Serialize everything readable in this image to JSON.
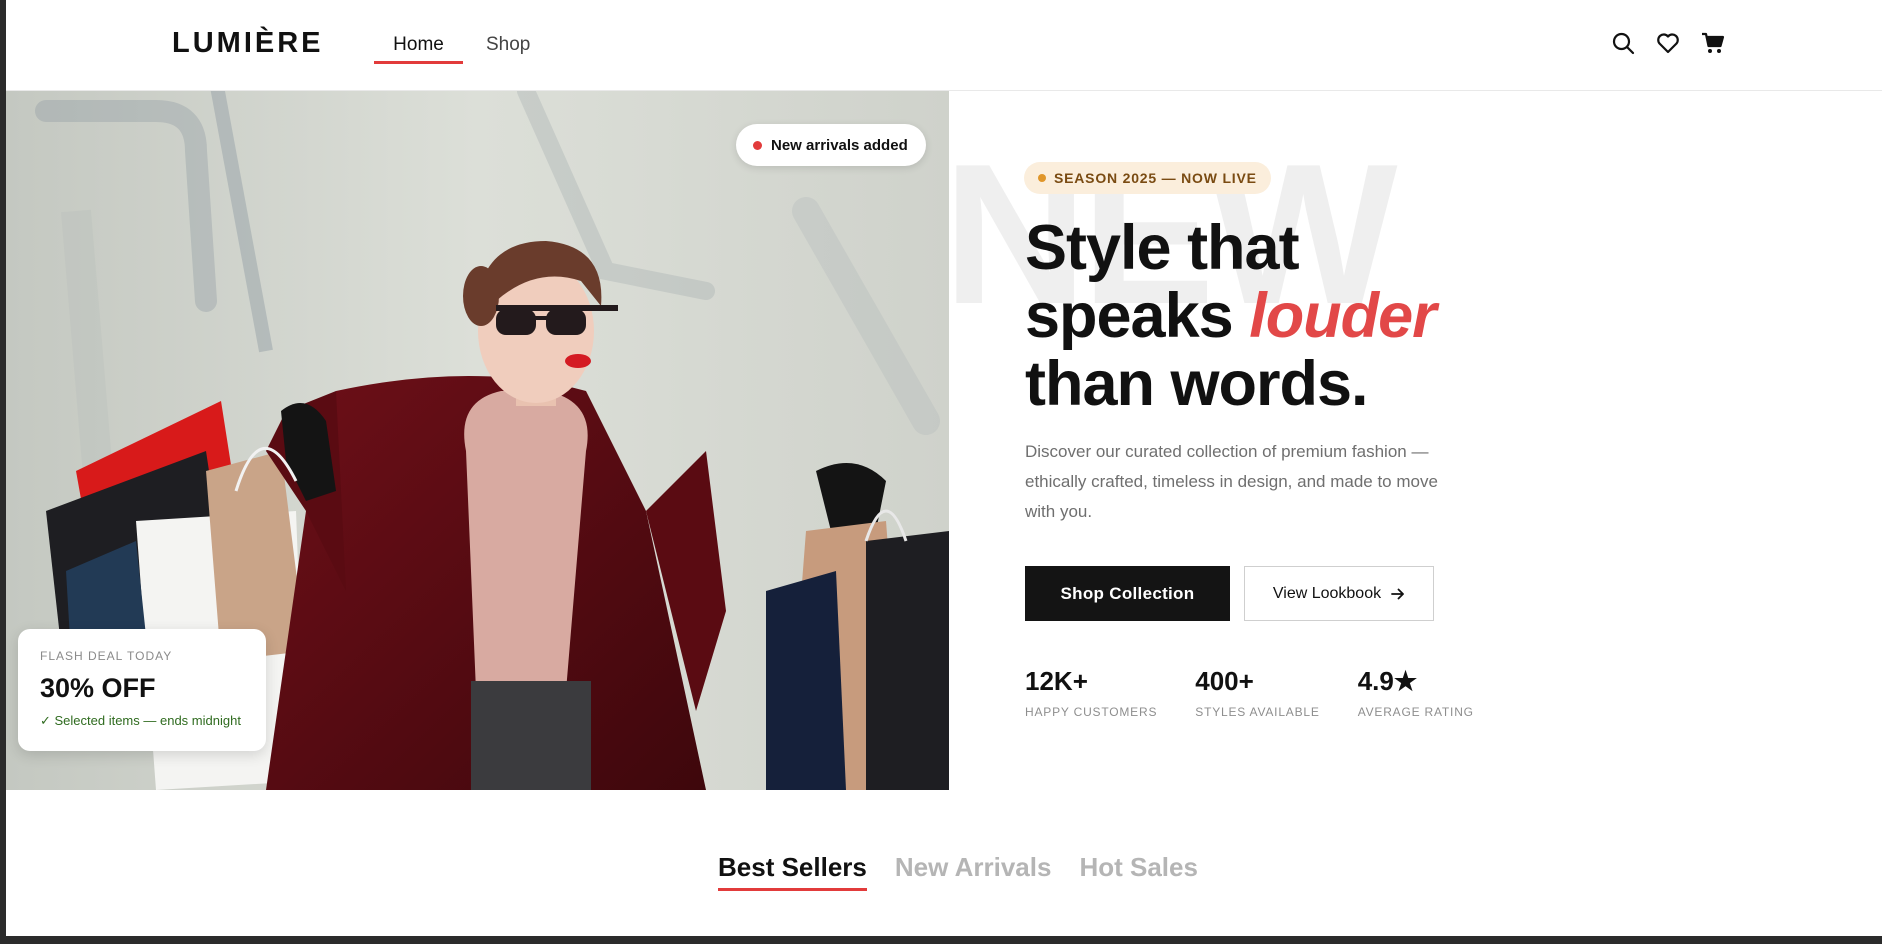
{
  "header": {
    "logo": "LUMIÈRE",
    "nav": [
      {
        "label": "Home",
        "active": true
      },
      {
        "label": "Shop",
        "active": false
      }
    ],
    "icons": [
      "search-icon",
      "heart-icon",
      "cart-icon"
    ]
  },
  "hero_image": {
    "badge": "New arrivals added",
    "deal": {
      "eyebrow": "FLASH DEAL TODAY",
      "title": "30% OFF",
      "note": "✓ Selected items — ends midnight"
    }
  },
  "hero": {
    "ghost_word": "NEW",
    "season_tag": "SEASON 2025 — NOW LIVE",
    "headline": {
      "line1": "Style that",
      "line2_plain": "speaks ",
      "line2_accent": "louder",
      "line3": "than words."
    },
    "lede": "Discover our curated collection of premium fashion — ethically crafted, timeless in design, and made to move with you.",
    "primary_cta": "Shop Collection",
    "secondary_cta": "View Lookbook",
    "stats": [
      {
        "value": "12K+",
        "label": "HAPPY CUSTOMERS"
      },
      {
        "value": "400+",
        "label": "STYLES AVAILABLE"
      },
      {
        "value": "4.9★",
        "label": "AVERAGE RATING"
      }
    ]
  },
  "tabs": [
    {
      "label": "Best Sellers",
      "active": true
    },
    {
      "label": "New Arrivals",
      "active": false
    },
    {
      "label": "Hot Sales",
      "active": false
    }
  ],
  "colors": {
    "accent": "#e23b3b",
    "dark": "#141414",
    "season_tag_bg": "#fbeedc",
    "deal_note": "#2f6b1f"
  }
}
